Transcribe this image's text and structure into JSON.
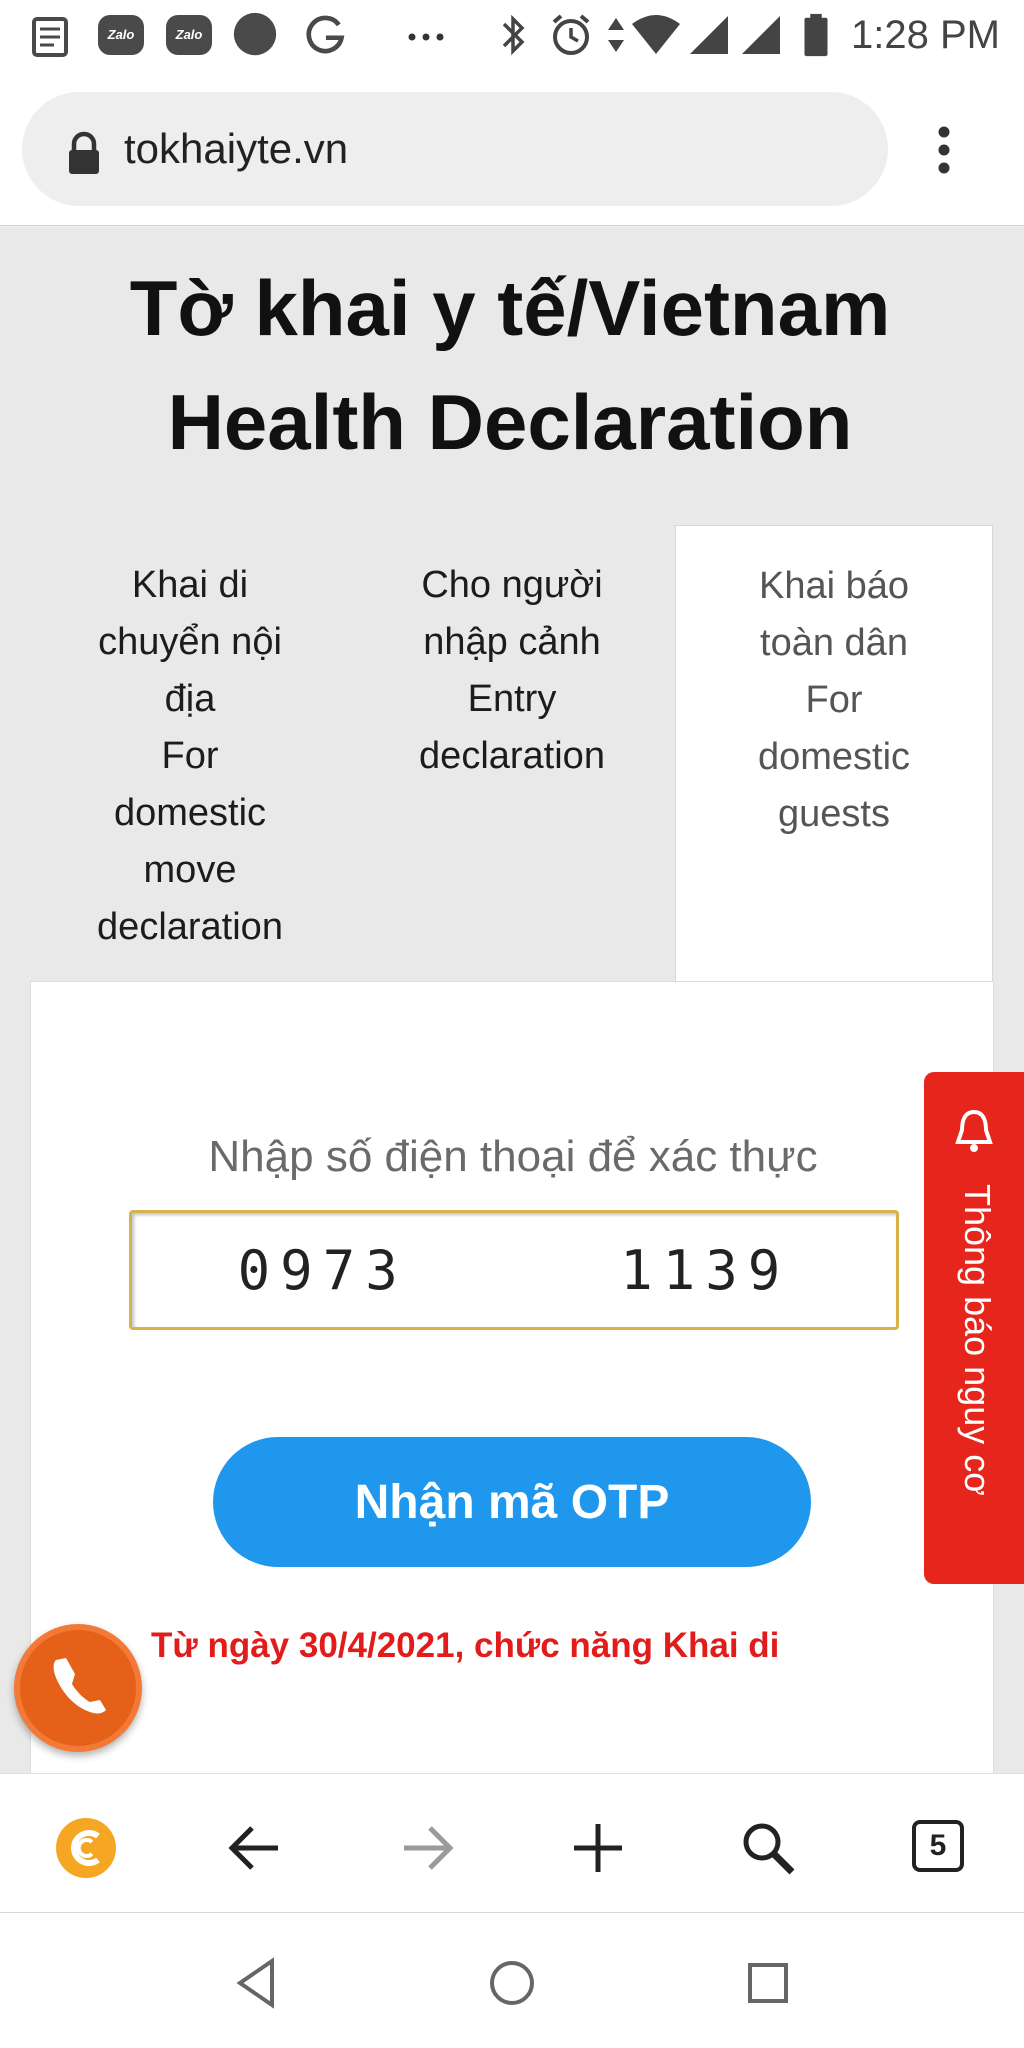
{
  "status_bar": {
    "time": "1:28 PM",
    "zalo_label": "Zalo",
    "notification_icons": [
      "news-icon",
      "zalo-icon",
      "zalo-icon",
      "circle-icon",
      "g-icon",
      "more-dots-icon"
    ],
    "system_icons": [
      "bluetooth-icon",
      "alarm-icon",
      "data-arrows-icon",
      "wifi-icon",
      "signal-icon",
      "signal-icon",
      "battery-icon"
    ]
  },
  "browser": {
    "url": "tokhaiyte.vn",
    "open_tab_count": "5"
  },
  "page": {
    "title": "Tờ khai y tế/Vietnam Health Declaration",
    "tabs": [
      {
        "lines": [
          "Khai di",
          "chuyển nội",
          "địa",
          "For",
          "domestic",
          "move",
          "declaration"
        ]
      },
      {
        "lines": [
          "Cho người",
          "nhập cảnh",
          "Entry",
          "declaration"
        ]
      },
      {
        "lines": [
          "Khai báo",
          "toàn dân",
          "For",
          "domestic",
          "guests"
        ],
        "active": true
      }
    ],
    "phone_label": "Nhập số điện thoại để xác thực",
    "phone_value": "0973     1139",
    "otp_button": "Nhận mã OTP",
    "notice": "Từ ngày 30/4/2021, chức năng Khai di",
    "risk_tab_label": "Thông báo nguy cơ"
  },
  "colors": {
    "page_bg": "#e9e9e9",
    "otp_button": "#1e97ec",
    "notice_text": "#e21b1b",
    "risk_tab": "#e6261c",
    "call_button": "#e56019",
    "input_border": "#d8b24a"
  }
}
